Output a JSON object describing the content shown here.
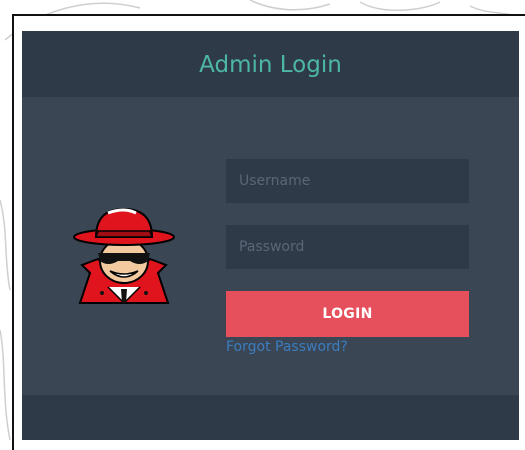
{
  "login": {
    "title": "Admin Login",
    "username_placeholder": "Username",
    "username_value": "",
    "password_placeholder": "Password",
    "password_value": "",
    "login_label": "LOGIN",
    "forgot_label": "Forgot Password?"
  },
  "icons": {
    "avatar": "spy-mascot-icon"
  },
  "colors": {
    "background": "#ffffff",
    "panel": "#3b4655",
    "panel_dark": "#2f3a49",
    "title": "#4cb7a5",
    "button": "#e5505c",
    "link": "#3b7dbf"
  }
}
